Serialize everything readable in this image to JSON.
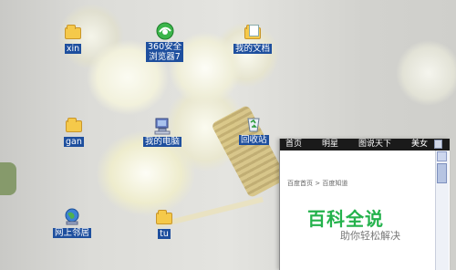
{
  "desktop": {
    "icons": [
      {
        "label": "xin"
      },
      {
        "label": "360安全\n浏览器7"
      },
      {
        "label": "我的文档"
      },
      {
        "label": "gan"
      },
      {
        "label": "我的电脑"
      },
      {
        "label": "回收站"
      },
      {
        "label": "网上邻居"
      },
      {
        "label": "tu"
      }
    ]
  },
  "browser": {
    "tabs": [
      "首页",
      "明星",
      "图说天下",
      "美女"
    ],
    "breadcrumb": "百度首页 > 百度知道",
    "brand": "百科全说",
    "slogan": "助你轻松解决"
  },
  "colors": {
    "label_bg": "#1e4f9e",
    "brand_green": "#24b24c"
  }
}
